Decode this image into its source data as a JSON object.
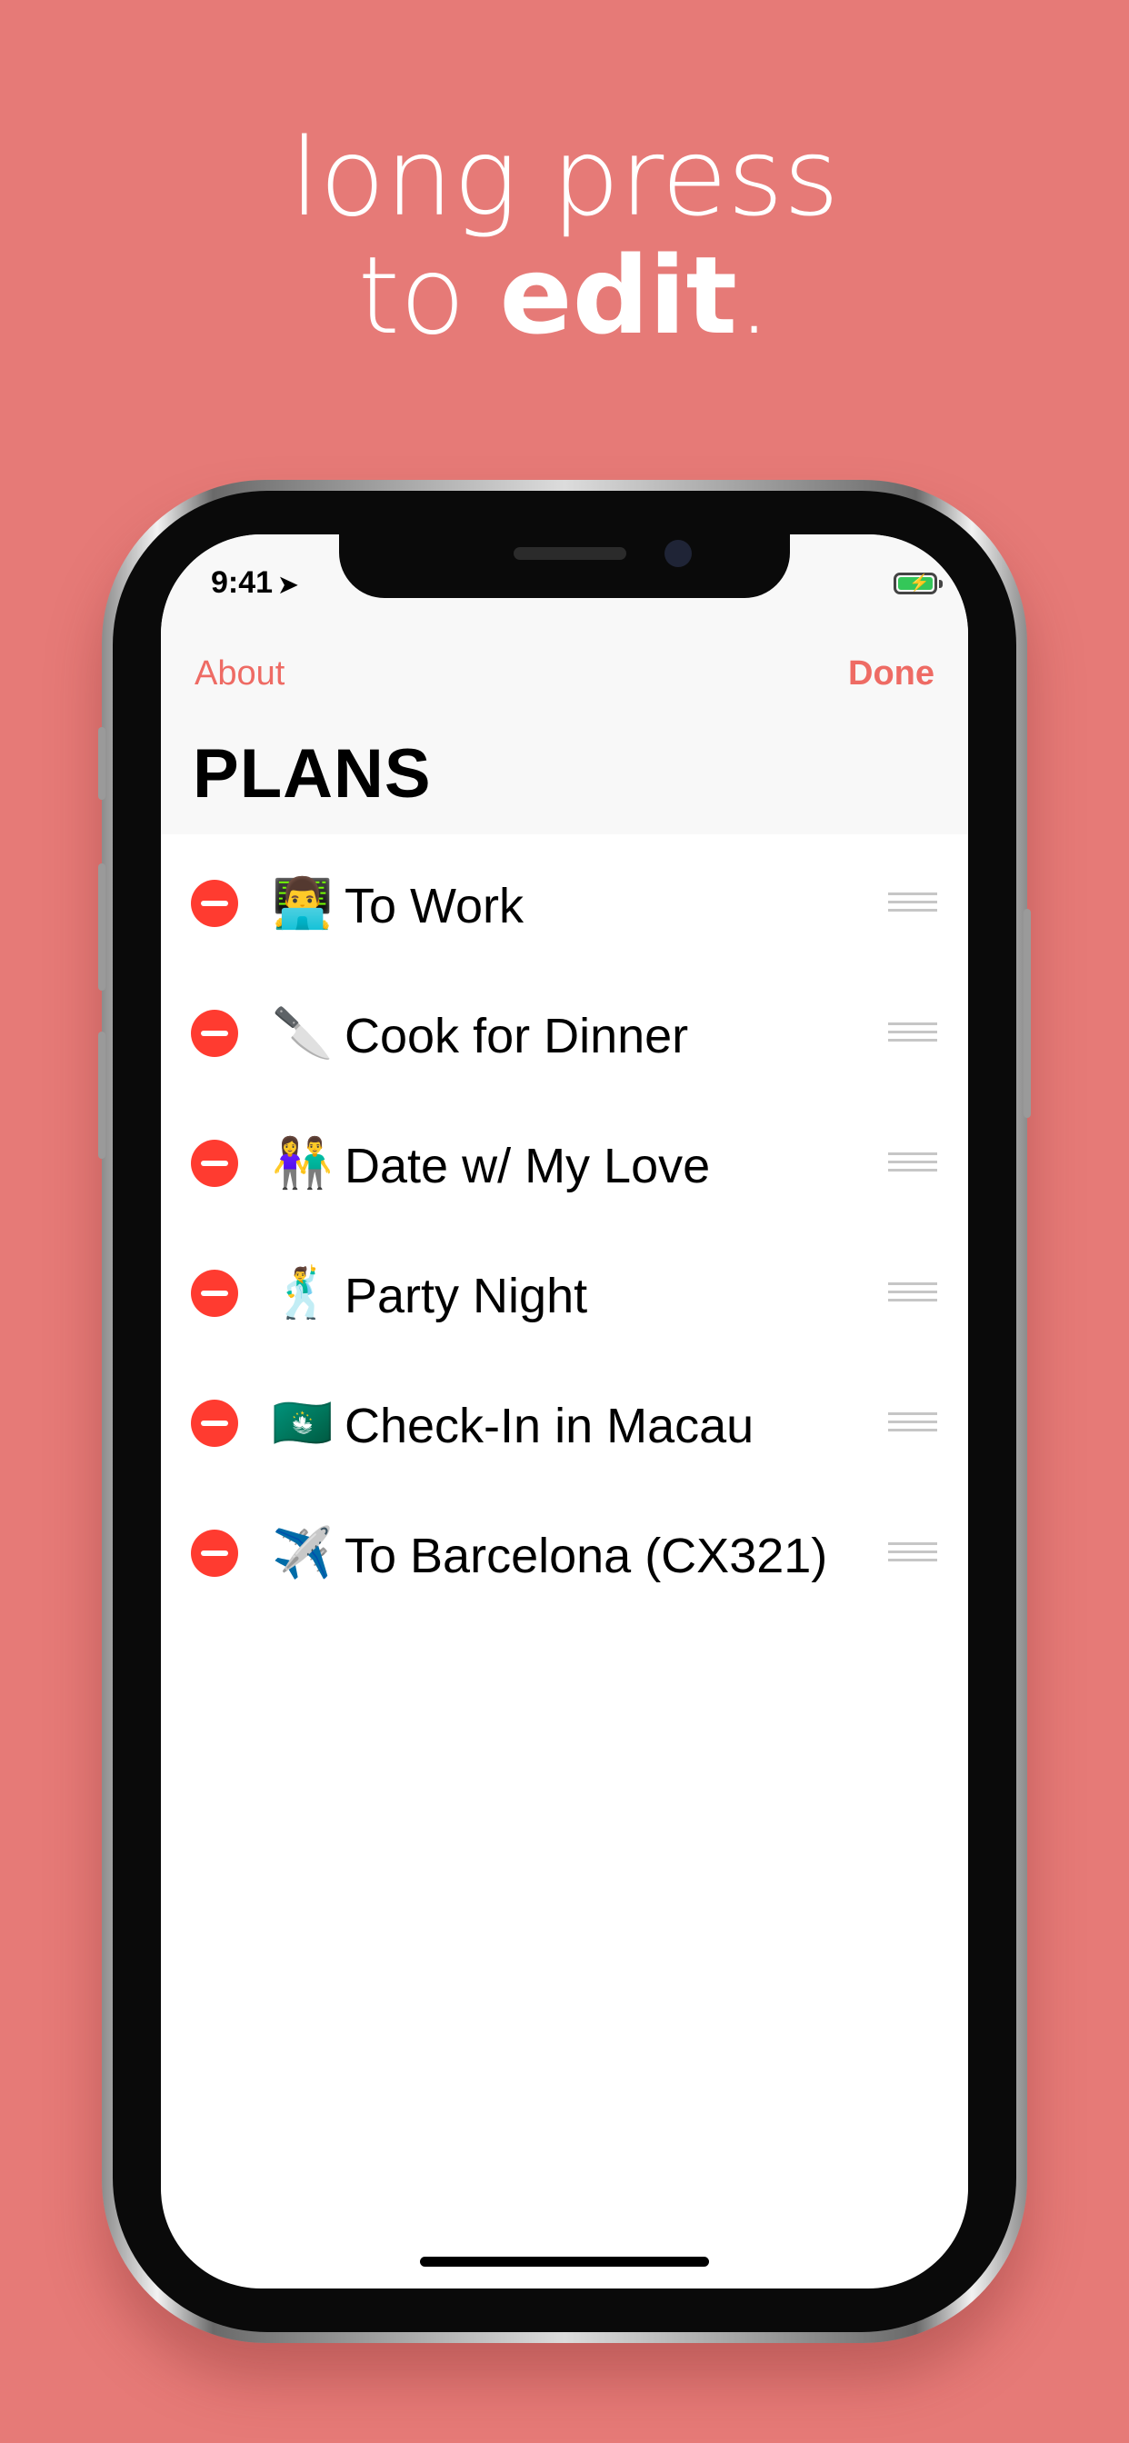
{
  "headline": {
    "line1": "long press",
    "line2_pre": "to ",
    "line2_bold": "edit",
    "line2_post": "."
  },
  "status": {
    "time": "9:41",
    "location_icon": "location-arrow-icon",
    "battery_icon": "battery-charging-icon"
  },
  "nav": {
    "left": "About",
    "right": "Done"
  },
  "page_title": "PLANS",
  "rows": [
    {
      "emoji": "👨‍💻",
      "label": "To Work"
    },
    {
      "emoji": "🔪",
      "label": "Cook for Dinner"
    },
    {
      "emoji": "👫",
      "label": "Date w/ My Love"
    },
    {
      "emoji": "🕺",
      "label": "Party Night"
    },
    {
      "emoji": "🇲🇴",
      "label": "Check-In in Macau"
    },
    {
      "emoji": "✈️",
      "label": "To Barcelona (CX321)"
    }
  ],
  "colors": {
    "background": "#E67A77",
    "accent": "#EE6B64",
    "delete": "#FF3B30"
  }
}
